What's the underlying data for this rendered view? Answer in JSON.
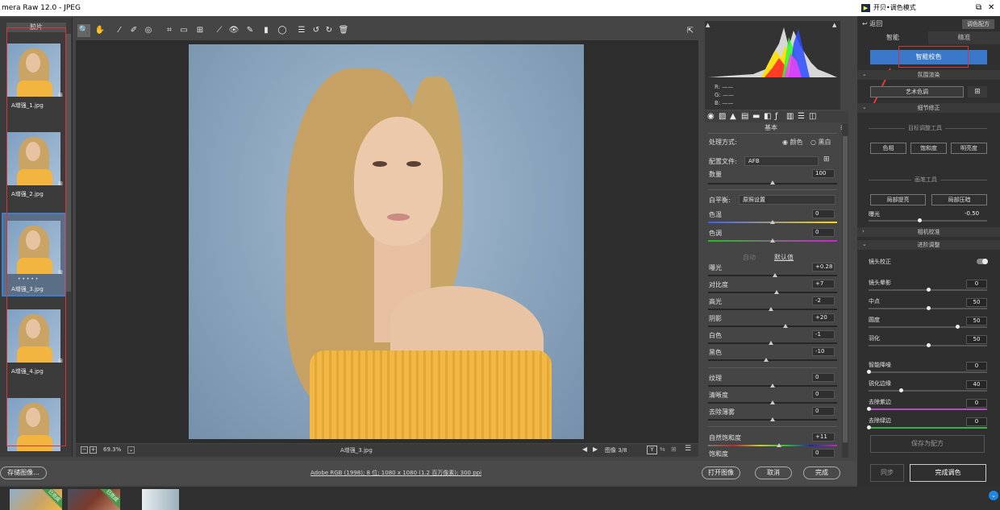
{
  "window": {
    "title": "mera Raw 12.0 -  JPEG"
  },
  "filmstrip": {
    "header": "胶片",
    "items": [
      {
        "name": "A增强_1.jpg"
      },
      {
        "name": "A增强_2.jpg"
      },
      {
        "name": "A增强_3.jpg",
        "stars": "• • • • •"
      },
      {
        "name": "A增强_4.jpg"
      },
      {
        "name": ""
      }
    ]
  },
  "toolbar": {
    "icons": [
      "zoom-icon",
      "hand-icon",
      "white-balance-icon",
      "color-sampler-icon",
      "target-adjust-icon",
      "crop-icon",
      "straighten-icon",
      "transform-icon",
      "spot-removal-icon",
      "red-eye-icon",
      "brush-icon",
      "graduated-filter-icon",
      "radial-filter-icon",
      "presets-icon",
      "rotate-left-icon",
      "rotate-right-icon",
      "trash-icon"
    ],
    "glyphs": [
      "🔍",
      "✋",
      "⁄",
      "✐",
      "◎",
      "⌗",
      "▭",
      "⊞",
      "⟋",
      "👁",
      "✎",
      "▮",
      "◯",
      "☰",
      "↺",
      "↻",
      "🗑"
    ],
    "fullscreen_glyph": "⇱"
  },
  "canvas": {
    "zoom": "69.3%",
    "filename": "A增强_3.jpg",
    "image_counter": "图像 3/8",
    "y_button": "Y"
  },
  "histogram": {
    "r": "R:  ——",
    "g": "G:  ——",
    "b": "B:  ——"
  },
  "basic": {
    "title": "基本",
    "treatment_label": "处理方式:",
    "color_option": "颜色",
    "bw_option": "黑白",
    "profile_label": "配置文件:",
    "profile_value": "AFB",
    "amount_label": "数量",
    "amount_value": "100",
    "wb_label": "白平衡:",
    "wb_value": "原照设置",
    "temp_label": "色温",
    "temp_value": "0",
    "tint_label": "色调",
    "tint_value": "0",
    "auto_label": "自动",
    "default_label": "默认值",
    "sliders": [
      {
        "label": "曝光",
        "value": "+0.28",
        "pos": 0.52
      },
      {
        "label": "对比度",
        "value": "+7",
        "pos": 0.53
      },
      {
        "label": "高光",
        "value": "-2",
        "pos": 0.49
      },
      {
        "label": "阴影",
        "value": "+20",
        "pos": 0.6
      },
      {
        "label": "白色",
        "value": "-1",
        "pos": 0.49
      },
      {
        "label": "黑色",
        "value": "-10",
        "pos": 0.45
      }
    ],
    "presence": [
      {
        "label": "纹理",
        "value": "0",
        "pos": 0.5
      },
      {
        "label": "清晰度",
        "value": "0",
        "pos": 0.5
      },
      {
        "label": "去除薄雾",
        "value": "0",
        "pos": 0.5
      }
    ],
    "vibrance_label": "自然饱和度",
    "vibrance_value": "+11",
    "saturation_label": "饱和度",
    "saturation_value": "0"
  },
  "bottom": {
    "save_image": "存储图像...",
    "info": "Adobe RGB (1998); 8 位; 1080 x 1080 (1.2 百万像素); 300 ppi",
    "open_image": "打开图像",
    "cancel": "取消",
    "done": "完成"
  },
  "bottom_strip": {
    "done_tags": [
      "已完成",
      "已完成"
    ]
  },
  "plugin": {
    "title": "开贝•调色模式",
    "back": "返回",
    "recipe": "调色配方",
    "tab_smart": "智能",
    "tab_fine": "精准",
    "smart_correct": "智能校色",
    "section_atmos": "氛围渲染",
    "art_tone": "艺术色调",
    "section_detail": "细节修正",
    "target_tools": "目标调整工具",
    "btn_hue": "色相",
    "btn_sat": "饱和度",
    "btn_lum": "明亮度",
    "brush_tools": "画笔工具",
    "local_brighten": "局部提亮",
    "local_darken": "局部压暗",
    "exposure_label": "曝光",
    "exposure_value": "-0.50",
    "section_camera": "相机校准",
    "section_advanced": "进阶调整",
    "lens_correction": "镜头校正",
    "rows": [
      {
        "label": "镜头晕影",
        "value": "0",
        "pos": 0.5
      },
      {
        "label": "中点",
        "value": "50",
        "pos": 0.5
      },
      {
        "label": "圆度",
        "value": "50",
        "pos": 0.75
      },
      {
        "label": "羽化",
        "value": "50",
        "pos": 0.5
      },
      {
        "label": "智能降噪",
        "value": "0",
        "pos": 0.0
      },
      {
        "label": "锐化边缘",
        "value": "40",
        "pos": 0.27
      },
      {
        "label": "去除紫边",
        "value": "0",
        "pos": 0.0
      },
      {
        "label": "去除绿边",
        "value": "0",
        "pos": 0.0
      }
    ],
    "save_recipe": "保存为配方",
    "sync": "同步",
    "finish": "完成调色"
  },
  "colors": {
    "accent": "#3a78c9",
    "brand_red": "#e53935"
  }
}
